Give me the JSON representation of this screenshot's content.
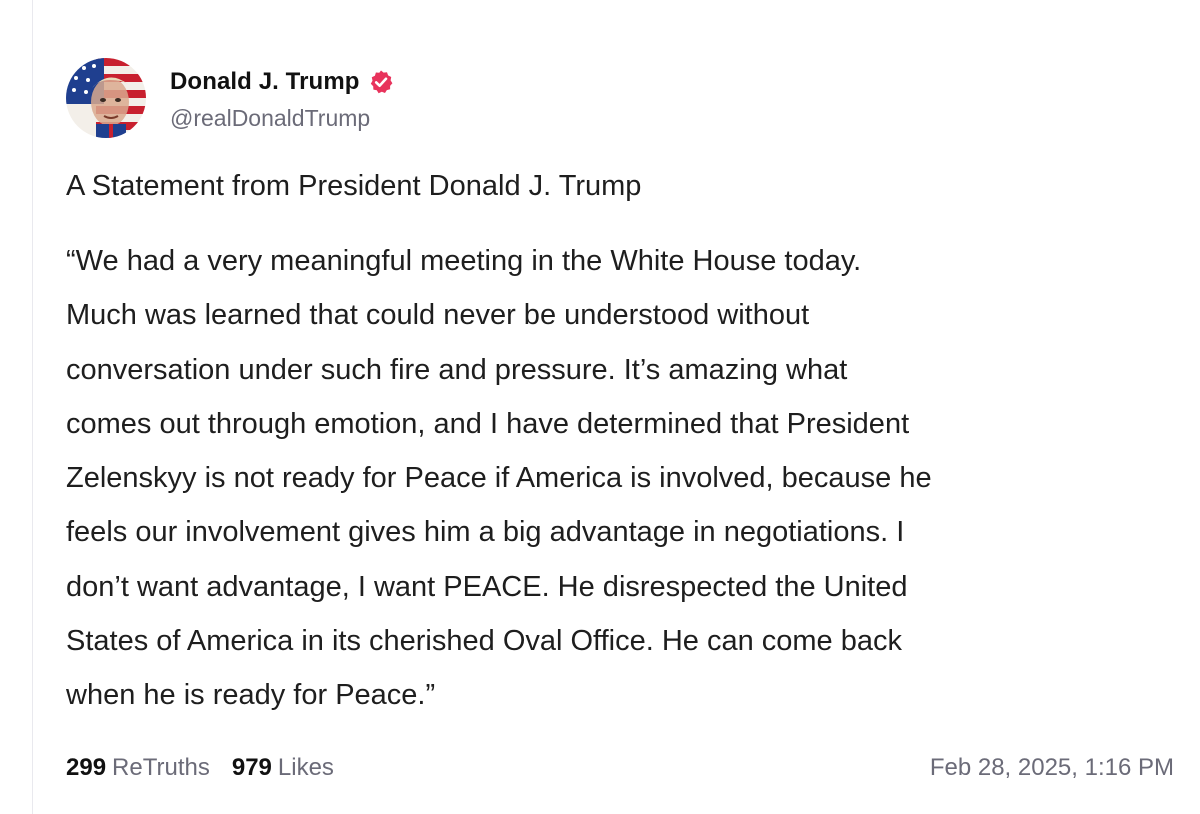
{
  "author": {
    "display_name": "Donald J. Trump",
    "handle": "@realDonaldTrump",
    "avatar_icon": "flag-portrait-avatar",
    "verified_icon": "verified-badge-icon",
    "verified_color": "#e8335c"
  },
  "post": {
    "title": "A Statement from President Donald J. Trump",
    "body_lines": [
      "“We had a very meaningful meeting in the White House today.",
      "Much was learned that could never be understood without",
      "conversation under such fire and pressure. It’s amazing what",
      "comes out through emotion, and I have determined that President",
      "Zelenskyy is not ready for Peace if America is involved, because he",
      "feels our involvement gives him a big advantage in negotiations. I",
      "don’t want advantage, I want PEACE. He disrespected the United",
      "States of America in its cherished Oval Office. He can come back",
      "when he is ready for Peace.”"
    ]
  },
  "stats": {
    "retruths_count": "299",
    "retruths_label": "ReTruths",
    "likes_count": "979",
    "likes_label": "Likes"
  },
  "timestamp": "Feb 28, 2025, 1:16 PM"
}
